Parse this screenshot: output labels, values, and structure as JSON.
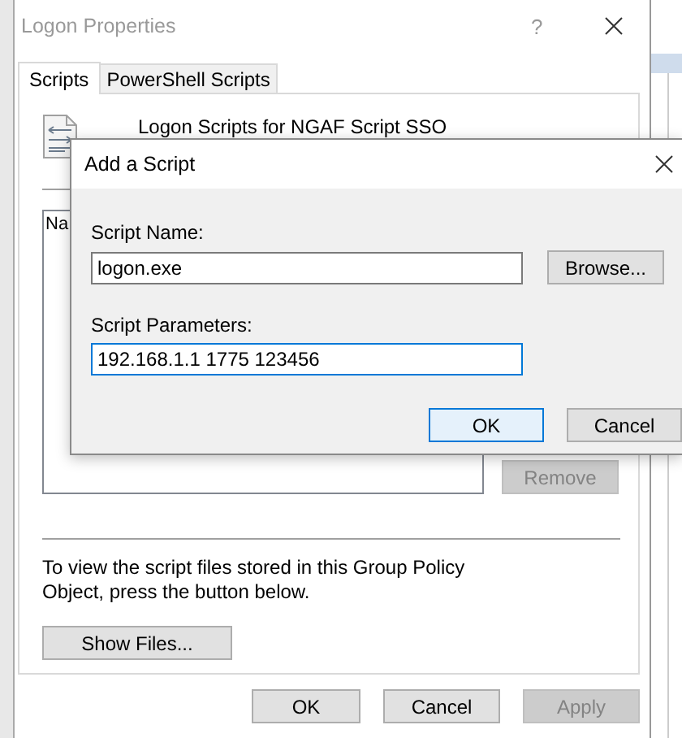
{
  "window": {
    "title": "Logon Properties",
    "help_button": "?"
  },
  "tabs": [
    {
      "label": "Scripts",
      "selected": true
    },
    {
      "label": "PowerShell Scripts",
      "selected": false
    }
  ],
  "scripts_heading": "Logon Scripts for NGAF Script SSO",
  "list_column": "Na",
  "remove_button": {
    "label": "Remove",
    "disabled": true
  },
  "info_text": "To view the script files stored in this Group Policy Object, press the button below.",
  "show_files_button": "Show Files...",
  "buttons": [
    {
      "label": "OK",
      "disabled": false
    },
    {
      "label": "Cancel",
      "disabled": false
    },
    {
      "label": "Apply",
      "disabled": true
    }
  ],
  "dialog": {
    "title": "Add a Script",
    "browse_button": "Browse...",
    "fields": [
      {
        "label": "Script Name:",
        "value": "logon.exe",
        "focused": false
      },
      {
        "label": "Script Parameters:",
        "value": "192.168.1.1 1775 123456",
        "focused": true
      }
    ],
    "buttons": [
      {
        "label": "OK",
        "default": true
      },
      {
        "label": "Cancel",
        "default": false
      }
    ]
  }
}
